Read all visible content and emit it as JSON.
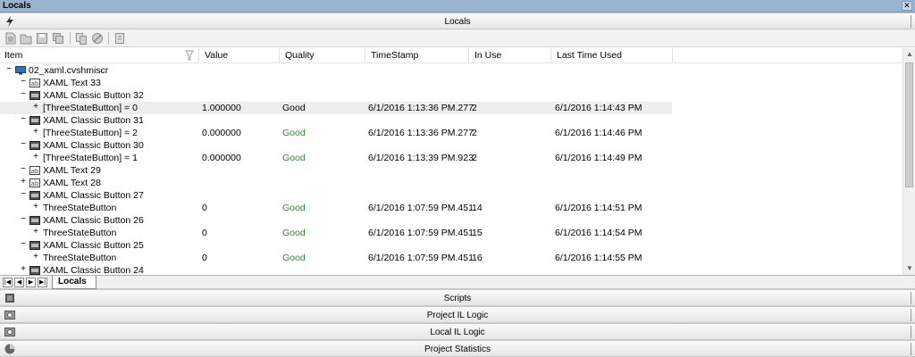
{
  "window": {
    "title": "Locals"
  },
  "locals_bar": {
    "label": "Locals",
    "icon": "lightning-icon"
  },
  "toolbar": {
    "icons": [
      "new-icon",
      "open-icon",
      "save-icon",
      "save-all-icon",
      "copy-icon",
      "disable-icon",
      "clear-icon"
    ]
  },
  "columns": {
    "item": "Item",
    "value": "Value",
    "quality": "Quality",
    "timestamp": "TimeStamp",
    "inuse": "In Use",
    "lastused": "Last Time Used"
  },
  "rows": [
    {
      "exp": "−",
      "icon": "monitor-icon",
      "item": "02_xaml.cvshmiscr",
      "value": "",
      "quality": "",
      "timestamp": "",
      "inuse": "",
      "lastused": ""
    },
    {
      "exp": "−",
      "icon": "ab-icon",
      "item": "XAML Text 33",
      "value": "",
      "quality": "",
      "timestamp": "",
      "inuse": "",
      "lastused": ""
    },
    {
      "exp": "−",
      "icon": "button-icon",
      "item": "XAML Classic Button 32",
      "value": "",
      "quality": "",
      "timestamp": "",
      "inuse": "",
      "lastused": ""
    },
    {
      "exp": "+",
      "icon": "",
      "item": "[ThreeStateButton] = 0",
      "value": "1.000000",
      "quality": "Good",
      "timestamp": "6/1/2016 1:13:36 PM.277",
      "inuse": "2",
      "lastused": "6/1/2016 1:14:43 PM"
    },
    {
      "exp": "−",
      "icon": "button-icon",
      "item": "XAML Classic Button 31",
      "value": "",
      "quality": "",
      "timestamp": "",
      "inuse": "",
      "lastused": ""
    },
    {
      "exp": "+",
      "icon": "",
      "item": "[ThreeStateButton] = 2",
      "value": "0.000000",
      "quality": "Good",
      "timestamp": "6/1/2016 1:13:36 PM.277",
      "inuse": "2",
      "lastused": "6/1/2016 1:14:46 PM"
    },
    {
      "exp": "−",
      "icon": "button-icon",
      "item": "XAML Classic Button 30",
      "value": "",
      "quality": "",
      "timestamp": "",
      "inuse": "",
      "lastused": ""
    },
    {
      "exp": "+",
      "icon": "",
      "item": "[ThreeStateButton] = 1",
      "value": "0.000000",
      "quality": "Good",
      "timestamp": "6/1/2016 1:13:39 PM.923",
      "inuse": "2",
      "lastused": "6/1/2016 1:14:49 PM"
    },
    {
      "exp": "−",
      "icon": "ab-icon",
      "item": "XAML Text 29",
      "value": "",
      "quality": "",
      "timestamp": "",
      "inuse": "",
      "lastused": ""
    },
    {
      "exp": "+",
      "icon": "ab-icon",
      "item": "XAML Text 28",
      "value": "",
      "quality": "",
      "timestamp": "",
      "inuse": "",
      "lastused": ""
    },
    {
      "exp": "−",
      "icon": "button-icon",
      "item": "XAML Classic Button 27",
      "value": "",
      "quality": "",
      "timestamp": "",
      "inuse": "",
      "lastused": ""
    },
    {
      "exp": "+",
      "icon": "",
      "item": "ThreeStateButton",
      "value": "0",
      "quality": "Good",
      "timestamp": "6/1/2016 1:07:59 PM.451",
      "inuse": "14",
      "lastused": "6/1/2016 1:14:51 PM"
    },
    {
      "exp": "−",
      "icon": "button-icon",
      "item": "XAML Classic Button 26",
      "value": "",
      "quality": "",
      "timestamp": "",
      "inuse": "",
      "lastused": ""
    },
    {
      "exp": "+",
      "icon": "",
      "item": "ThreeStateButton",
      "value": "0",
      "quality": "Good",
      "timestamp": "6/1/2016 1:07:59 PM.451",
      "inuse": "15",
      "lastused": "6/1/2016 1:14:54 PM"
    },
    {
      "exp": "−",
      "icon": "button-icon",
      "item": "XAML Classic Button 25",
      "value": "",
      "quality": "",
      "timestamp": "",
      "inuse": "",
      "lastused": ""
    },
    {
      "exp": "+",
      "icon": "",
      "item": "ThreeStateButton",
      "value": "0",
      "quality": "Good",
      "timestamp": "6/1/2016 1:07:59 PM.451",
      "inuse": "16",
      "lastused": "6/1/2016 1:14:55 PM"
    },
    {
      "exp": "+",
      "icon": "button-icon",
      "item": "XAML Classic Button 24",
      "value": "",
      "quality": "",
      "timestamp": "",
      "inuse": "",
      "lastused": ""
    }
  ],
  "selected_row": 3,
  "tabs": {
    "active": "Locals"
  },
  "panels": [
    {
      "label": "Scripts",
      "icon": "scripts-icon"
    },
    {
      "label": "Project IL Logic",
      "icon": "project-il-logic-icon"
    },
    {
      "label": "Local IL Logic",
      "icon": "local-il-logic-icon"
    },
    {
      "label": "Project Statistics",
      "icon": "pie-chart-icon"
    }
  ],
  "colors": {
    "title_bar": "#99b4d1",
    "good": "#2e8b2e",
    "selected_row": "#eeeeee"
  }
}
